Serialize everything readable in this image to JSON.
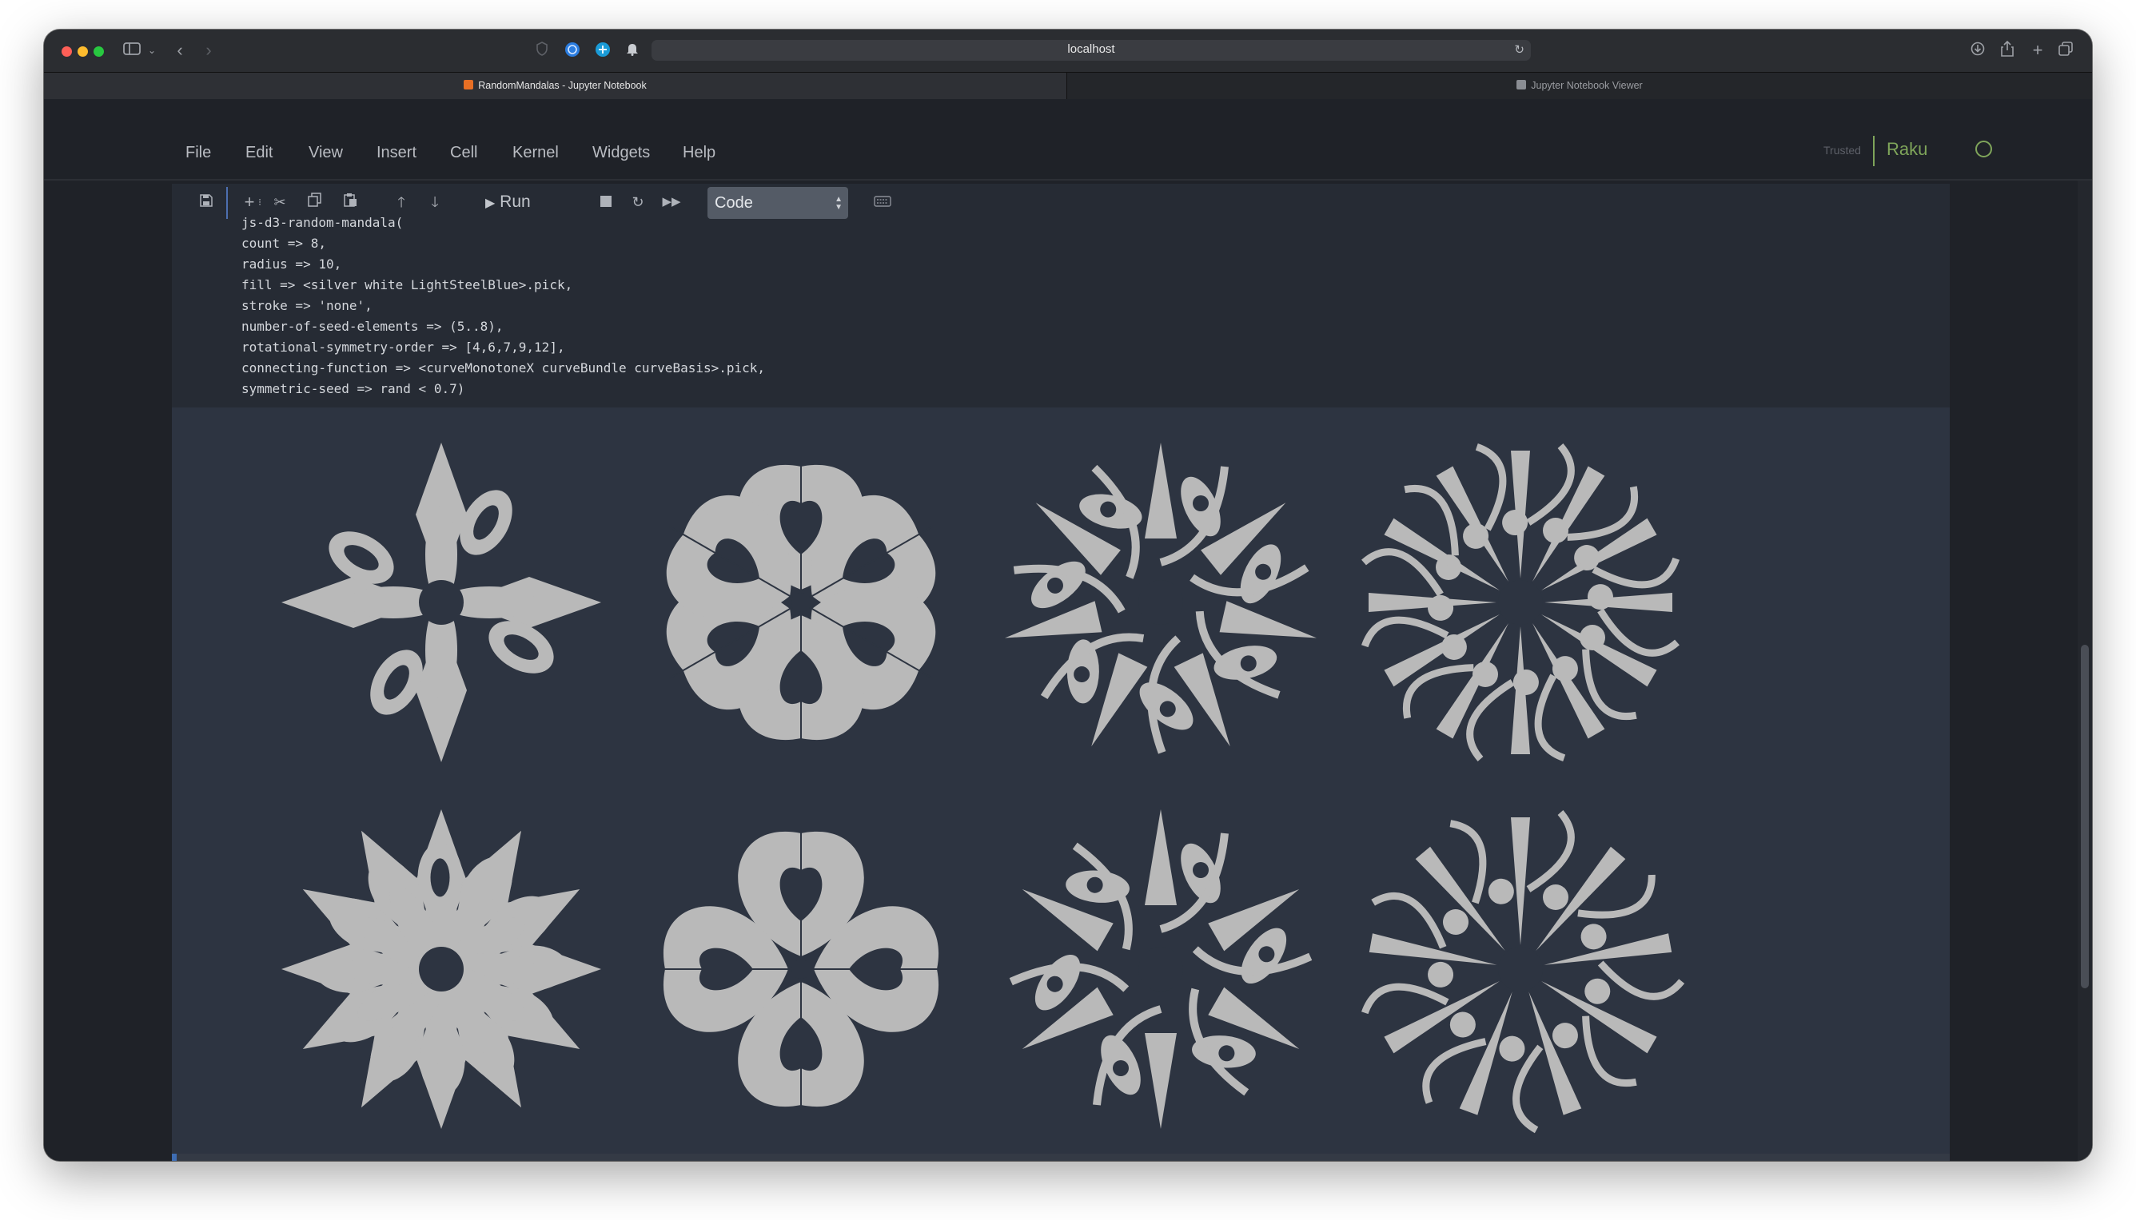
{
  "browser": {
    "url": "localhost",
    "tabs": [
      {
        "label": "RandomMandalas - Jupyter Notebook",
        "active": true
      },
      {
        "label": "Jupyter Notebook Viewer",
        "active": false
      }
    ]
  },
  "menu": {
    "items": [
      "File",
      "Edit",
      "View",
      "Insert",
      "Cell",
      "Kernel",
      "Widgets",
      "Help"
    ]
  },
  "kernel": {
    "trusted": "Trusted",
    "name": "Raku",
    "status_color": "#7fa55a"
  },
  "toolbar": {
    "run_label": "Run",
    "cell_type": "Code",
    "icons": [
      "save-icon",
      "add-cell-icon",
      "cut-icon",
      "copy-icon",
      "paste-icon",
      "move-up-icon",
      "move-down-icon",
      "play-icon",
      "stop-icon",
      "restart-icon",
      "fast-forward-icon",
      "keyboard-icon"
    ]
  },
  "code_cell": {
    "lines": [
      "js-d3-random-mandala(",
      "count => 8,",
      "radius => 10,",
      "fill => <silver white LightSteelBlue>.pick,",
      "stroke => 'none',",
      "number-of-seed-elements => (5..8),",
      "rotational-symmetry-order => [4,6,7,9,12],",
      "connecting-function => <curveMonotoneX curveBundle curveBasis>.pick,",
      "symmetric-seed => rand < 0.7)"
    ]
  },
  "output": {
    "mandala_count": 8,
    "fill": "#b9b9b9",
    "background": "#2d3441",
    "mandalas": [
      {
        "order": 4
      },
      {
        "order": 6
      },
      {
        "order": 7
      },
      {
        "order": 12
      },
      {
        "order": 12
      },
      {
        "order": 4
      },
      {
        "order": 6
      },
      {
        "order": 9
      }
    ]
  }
}
